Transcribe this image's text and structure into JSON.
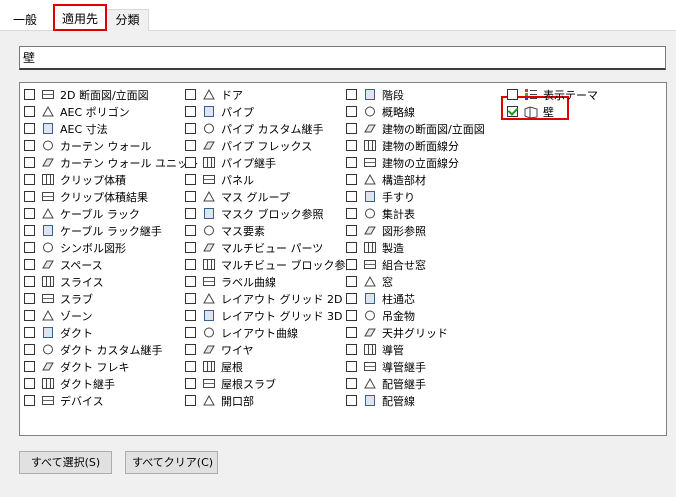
{
  "tabs": [
    {
      "label": "一般"
    },
    {
      "label": "適用先"
    },
    {
      "label": "分類"
    }
  ],
  "search": {
    "value": "壁"
  },
  "columns": [
    [
      {
        "label": "2D 断面図/立面図",
        "icon": "section-elevation-icon",
        "checked": false
      },
      {
        "label": "AEC ポリゴン",
        "icon": "polygon-icon",
        "checked": false
      },
      {
        "label": "AEC 寸法",
        "icon": "dimension-icon",
        "checked": false
      },
      {
        "label": "カーテン ウォール",
        "icon": "curtain-wall-icon",
        "checked": false
      },
      {
        "label": "カーテン ウォール ユニット",
        "icon": "curtain-wall-unit-icon",
        "checked": false
      },
      {
        "label": "クリップ体積",
        "icon": "clip-volume-icon",
        "checked": false
      },
      {
        "label": "クリップ体積結果",
        "icon": "clip-volume-result-icon",
        "checked": false
      },
      {
        "label": "ケーブル ラック",
        "icon": "cable-tray-icon",
        "checked": false
      },
      {
        "label": "ケーブル ラック継手",
        "icon": "cable-tray-fitting-icon",
        "checked": false
      },
      {
        "label": "シンボル図形",
        "icon": "symbol-icon",
        "checked": false
      },
      {
        "label": "スペース",
        "icon": "space-icon",
        "checked": false
      },
      {
        "label": "スライス",
        "icon": "slice-icon",
        "checked": false
      },
      {
        "label": "スラブ",
        "icon": "slab-icon",
        "checked": false
      },
      {
        "label": "ゾーン",
        "icon": "zone-icon",
        "checked": false
      },
      {
        "label": "ダクト",
        "icon": "duct-icon",
        "checked": false
      },
      {
        "label": "ダクト カスタム継手",
        "icon": "duct-custom-fitting-icon",
        "checked": false
      },
      {
        "label": "ダクト フレキ",
        "icon": "duct-flex-icon",
        "checked": false
      },
      {
        "label": "ダクト継手",
        "icon": "duct-fitting-icon",
        "checked": false
      },
      {
        "label": "デバイス",
        "icon": "device-icon",
        "checked": false
      }
    ],
    [
      {
        "label": "ドア",
        "icon": "door-icon",
        "checked": false
      },
      {
        "label": "パイプ",
        "icon": "pipe-icon",
        "checked": false
      },
      {
        "label": "パイプ カスタム継手",
        "icon": "pipe-custom-fitting-icon",
        "checked": false
      },
      {
        "label": "パイプ フレックス",
        "icon": "pipe-flex-icon",
        "checked": false
      },
      {
        "label": "パイプ継手",
        "icon": "pipe-fitting-icon",
        "checked": false
      },
      {
        "label": "パネル",
        "icon": "panel-icon",
        "checked": false
      },
      {
        "label": "マス グループ",
        "icon": "mass-group-icon",
        "checked": false
      },
      {
        "label": "マスク ブロック参照",
        "icon": "mask-block-icon",
        "checked": false
      },
      {
        "label": "マス要素",
        "icon": "mass-element-icon",
        "checked": false
      },
      {
        "label": "マルチビュー パーツ",
        "icon": "multiview-part-icon",
        "checked": false
      },
      {
        "label": "マルチビュー ブロック参照",
        "icon": "multiview-block-icon",
        "checked": false
      },
      {
        "label": "ラベル曲線",
        "icon": "label-curve-icon",
        "checked": false
      },
      {
        "label": "レイアウト グリッド 2D",
        "icon": "layout-grid-2d-icon",
        "checked": false
      },
      {
        "label": "レイアウト グリッド 3D",
        "icon": "layout-grid-3d-icon",
        "checked": false
      },
      {
        "label": "レイアウト曲線",
        "icon": "layout-curve-icon",
        "checked": false
      },
      {
        "label": "ワイヤ",
        "icon": "wire-icon",
        "checked": false
      },
      {
        "label": "屋根",
        "icon": "roof-icon",
        "checked": false
      },
      {
        "label": "屋根スラブ",
        "icon": "roof-slab-icon",
        "checked": false
      },
      {
        "label": "開口部",
        "icon": "opening-icon",
        "checked": false
      }
    ],
    [
      {
        "label": "階段",
        "icon": "stair-icon",
        "checked": false
      },
      {
        "label": "概略線",
        "icon": "schematic-line-icon",
        "checked": false
      },
      {
        "label": "建物の断面図/立面図",
        "icon": "building-section-icon",
        "checked": false
      },
      {
        "label": "建物の断面線分",
        "icon": "section-line-icon",
        "checked": false
      },
      {
        "label": "建物の立面線分",
        "icon": "elevation-line-icon",
        "checked": false
      },
      {
        "label": "構造部材",
        "icon": "structural-member-icon",
        "checked": false
      },
      {
        "label": "手すり",
        "icon": "railing-icon",
        "checked": false
      },
      {
        "label": "集計表",
        "icon": "schedule-table-icon",
        "checked": false
      },
      {
        "label": "図形参照",
        "icon": "shape-reference-icon",
        "checked": false
      },
      {
        "label": "製造",
        "icon": "fabrication-icon",
        "checked": false
      },
      {
        "label": "組合せ窓",
        "icon": "window-assembly-icon",
        "checked": false
      },
      {
        "label": "窓",
        "icon": "window-icon",
        "checked": false
      },
      {
        "label": "柱通芯",
        "icon": "column-grid-icon",
        "checked": false
      },
      {
        "label": "吊金物",
        "icon": "hanger-icon",
        "checked": false
      },
      {
        "label": "天井グリッド",
        "icon": "ceiling-grid-icon",
        "checked": false
      },
      {
        "label": "導管",
        "icon": "conduit-icon",
        "checked": false
      },
      {
        "label": "導管継手",
        "icon": "conduit-fitting-icon",
        "checked": false
      },
      {
        "label": "配管継手",
        "icon": "piping-fitting-icon",
        "checked": false
      },
      {
        "label": "配管線",
        "icon": "piping-line-icon",
        "checked": false
      }
    ],
    [
      {
        "label": "表示テーマ",
        "icon": "display-theme-icon",
        "checked": false
      },
      {
        "label": "壁",
        "icon": "wall-icon",
        "checked": true
      }
    ]
  ],
  "buttons": {
    "select_all": "すべて選択(S)",
    "clear_all": "すべてクリア(C)"
  },
  "colors": {
    "highlight": "#e00000",
    "checkmark": "#1a9a1a",
    "panel_bg": "#f0f0f0"
  }
}
